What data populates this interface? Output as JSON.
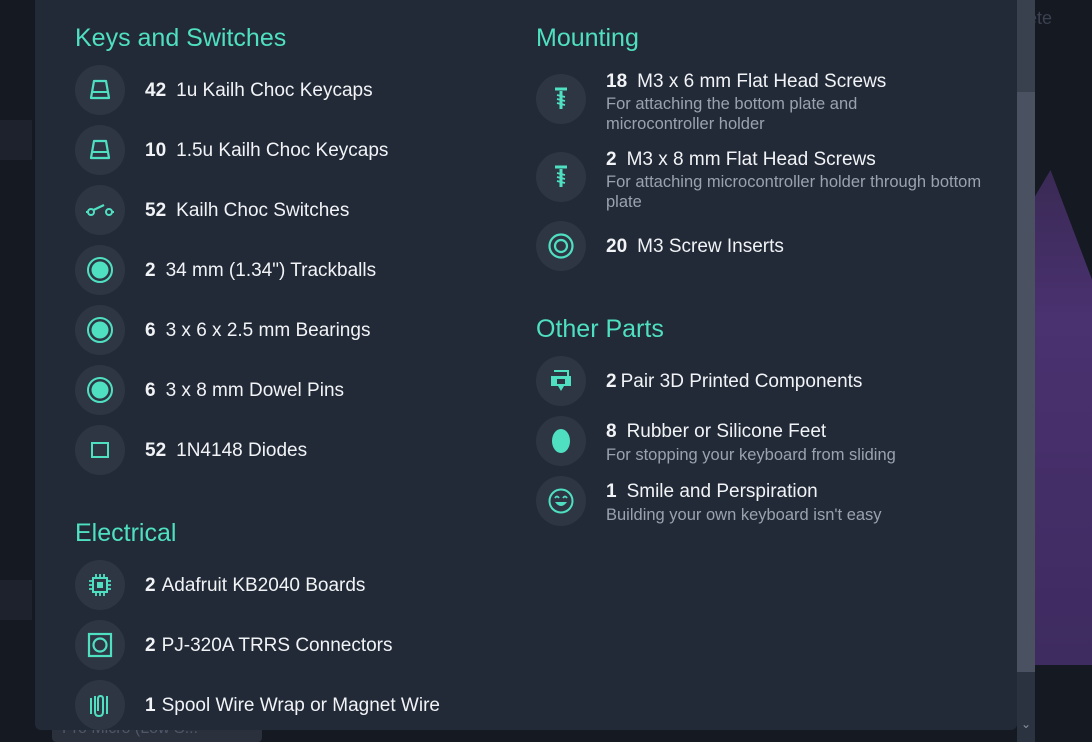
{
  "backdrop": {
    "top_right_text": "elete",
    "dropdown_text": "Pro Micro (Low S..."
  },
  "colors": {
    "accent": "#4fe0c1",
    "modal_bg": "#222a37",
    "icon_bg": "#2e3644",
    "text": "#f1f3f6",
    "muted": "#9aa2b0"
  },
  "sections": {
    "keys": {
      "title": "Keys and Switches",
      "items": [
        {
          "qty": "42",
          "name": "1u Kailh Choc Keycaps",
          "icon": "keycap-icon"
        },
        {
          "qty": "10",
          "name": "1.5u Kailh Choc Keycaps",
          "icon": "keycap-icon"
        },
        {
          "qty": "52",
          "name": "Kailh Choc Switches",
          "icon": "switch-icon"
        },
        {
          "qty": "2",
          "name": "34 mm (1.34\") Trackballs",
          "icon": "ball-icon"
        },
        {
          "qty": "6",
          "name": "3 x 6 x 2.5 mm Bearings",
          "icon": "ball-icon"
        },
        {
          "qty": "6",
          "name": "3 x 8 mm Dowel Pins",
          "icon": "ball-icon"
        },
        {
          "qty": "52",
          "name": "1N4148 Diodes",
          "icon": "square-icon"
        }
      ]
    },
    "electrical": {
      "title": "Electrical",
      "items": [
        {
          "qty": "2",
          "name": "Adafruit KB2040 Boards",
          "icon": "chip-icon"
        },
        {
          "qty": "2",
          "name": "PJ-320A TRRS Connectors",
          "icon": "connector-icon"
        },
        {
          "qty": "1",
          "name": "Spool Wire Wrap or Magnet Wire",
          "icon": "wire-icon"
        }
      ]
    },
    "mounting": {
      "title": "Mounting",
      "items": [
        {
          "qty": "18",
          "name": "M3 x 6 mm Flat Head Screws",
          "desc": "For attaching the bottom plate and microcontroller holder",
          "icon": "screw-icon"
        },
        {
          "qty": "2",
          "name": "M3 x 8 mm Flat Head Screws",
          "desc": "For attaching microcontroller holder through bottom plate",
          "icon": "screw-icon"
        },
        {
          "qty": "20",
          "name": "M3 Screw Inserts",
          "icon": "insert-icon"
        }
      ]
    },
    "other": {
      "title": "Other Parts",
      "items": [
        {
          "qty": "2",
          "name": "Pair 3D Printed Components",
          "icon": "printer-icon"
        },
        {
          "qty": "8",
          "name": "Rubber or Silicone Feet",
          "desc": "For stopping your keyboard from sliding",
          "icon": "foot-icon"
        },
        {
          "qty": "1",
          "name": "Smile and Perspiration",
          "desc": "Building your own keyboard isn't easy",
          "icon": "smile-sweat-icon"
        }
      ]
    }
  }
}
